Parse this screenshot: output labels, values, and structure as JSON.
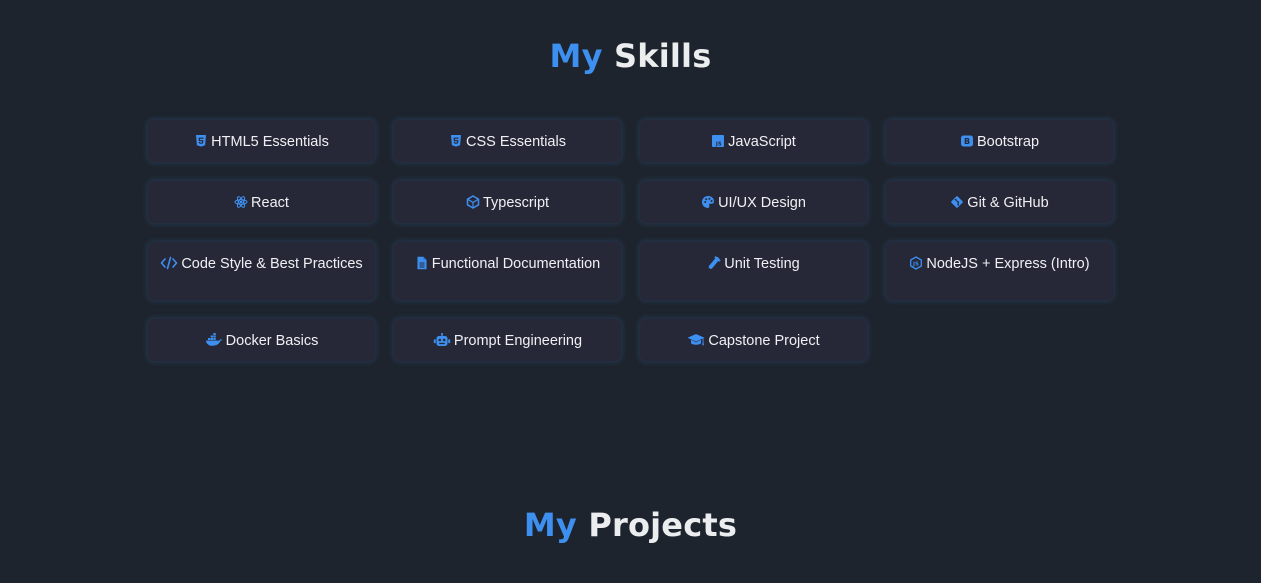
{
  "skills_section": {
    "title_accent": "My",
    "title_rest": "Skills",
    "skills": [
      {
        "label": "HTML5 Essentials",
        "icon": "html5-icon"
      },
      {
        "label": "CSS Essentials",
        "icon": "css3-icon"
      },
      {
        "label": "JavaScript",
        "icon": "javascript-icon"
      },
      {
        "label": "Bootstrap",
        "icon": "bootstrap-icon"
      },
      {
        "label": "React",
        "icon": "react-icon"
      },
      {
        "label": "Typescript",
        "icon": "typescript-icon"
      },
      {
        "label": "UI/UX Design",
        "icon": "palette-icon"
      },
      {
        "label": "Git & GitHub",
        "icon": "git-icon"
      },
      {
        "label": "Code Style & Best Practices",
        "icon": "code-icon"
      },
      {
        "label": "Functional Documentation",
        "icon": "document-icon"
      },
      {
        "label": "Unit Testing",
        "icon": "vial-icon"
      },
      {
        "label": "NodeJS + Express (Intro)",
        "icon": "nodejs-icon"
      },
      {
        "label": "Docker Basics",
        "icon": "docker-icon"
      },
      {
        "label": "Prompt Engineering",
        "icon": "robot-icon"
      },
      {
        "label": "Capstone Project",
        "icon": "graduation-cap-icon"
      }
    ]
  },
  "projects_section": {
    "title_accent": "My",
    "title_rest": "Projects"
  },
  "colors": {
    "background": "#1e242d",
    "accent": "#3d8ff0",
    "card": "#272837",
    "text": "#eef0f3"
  }
}
